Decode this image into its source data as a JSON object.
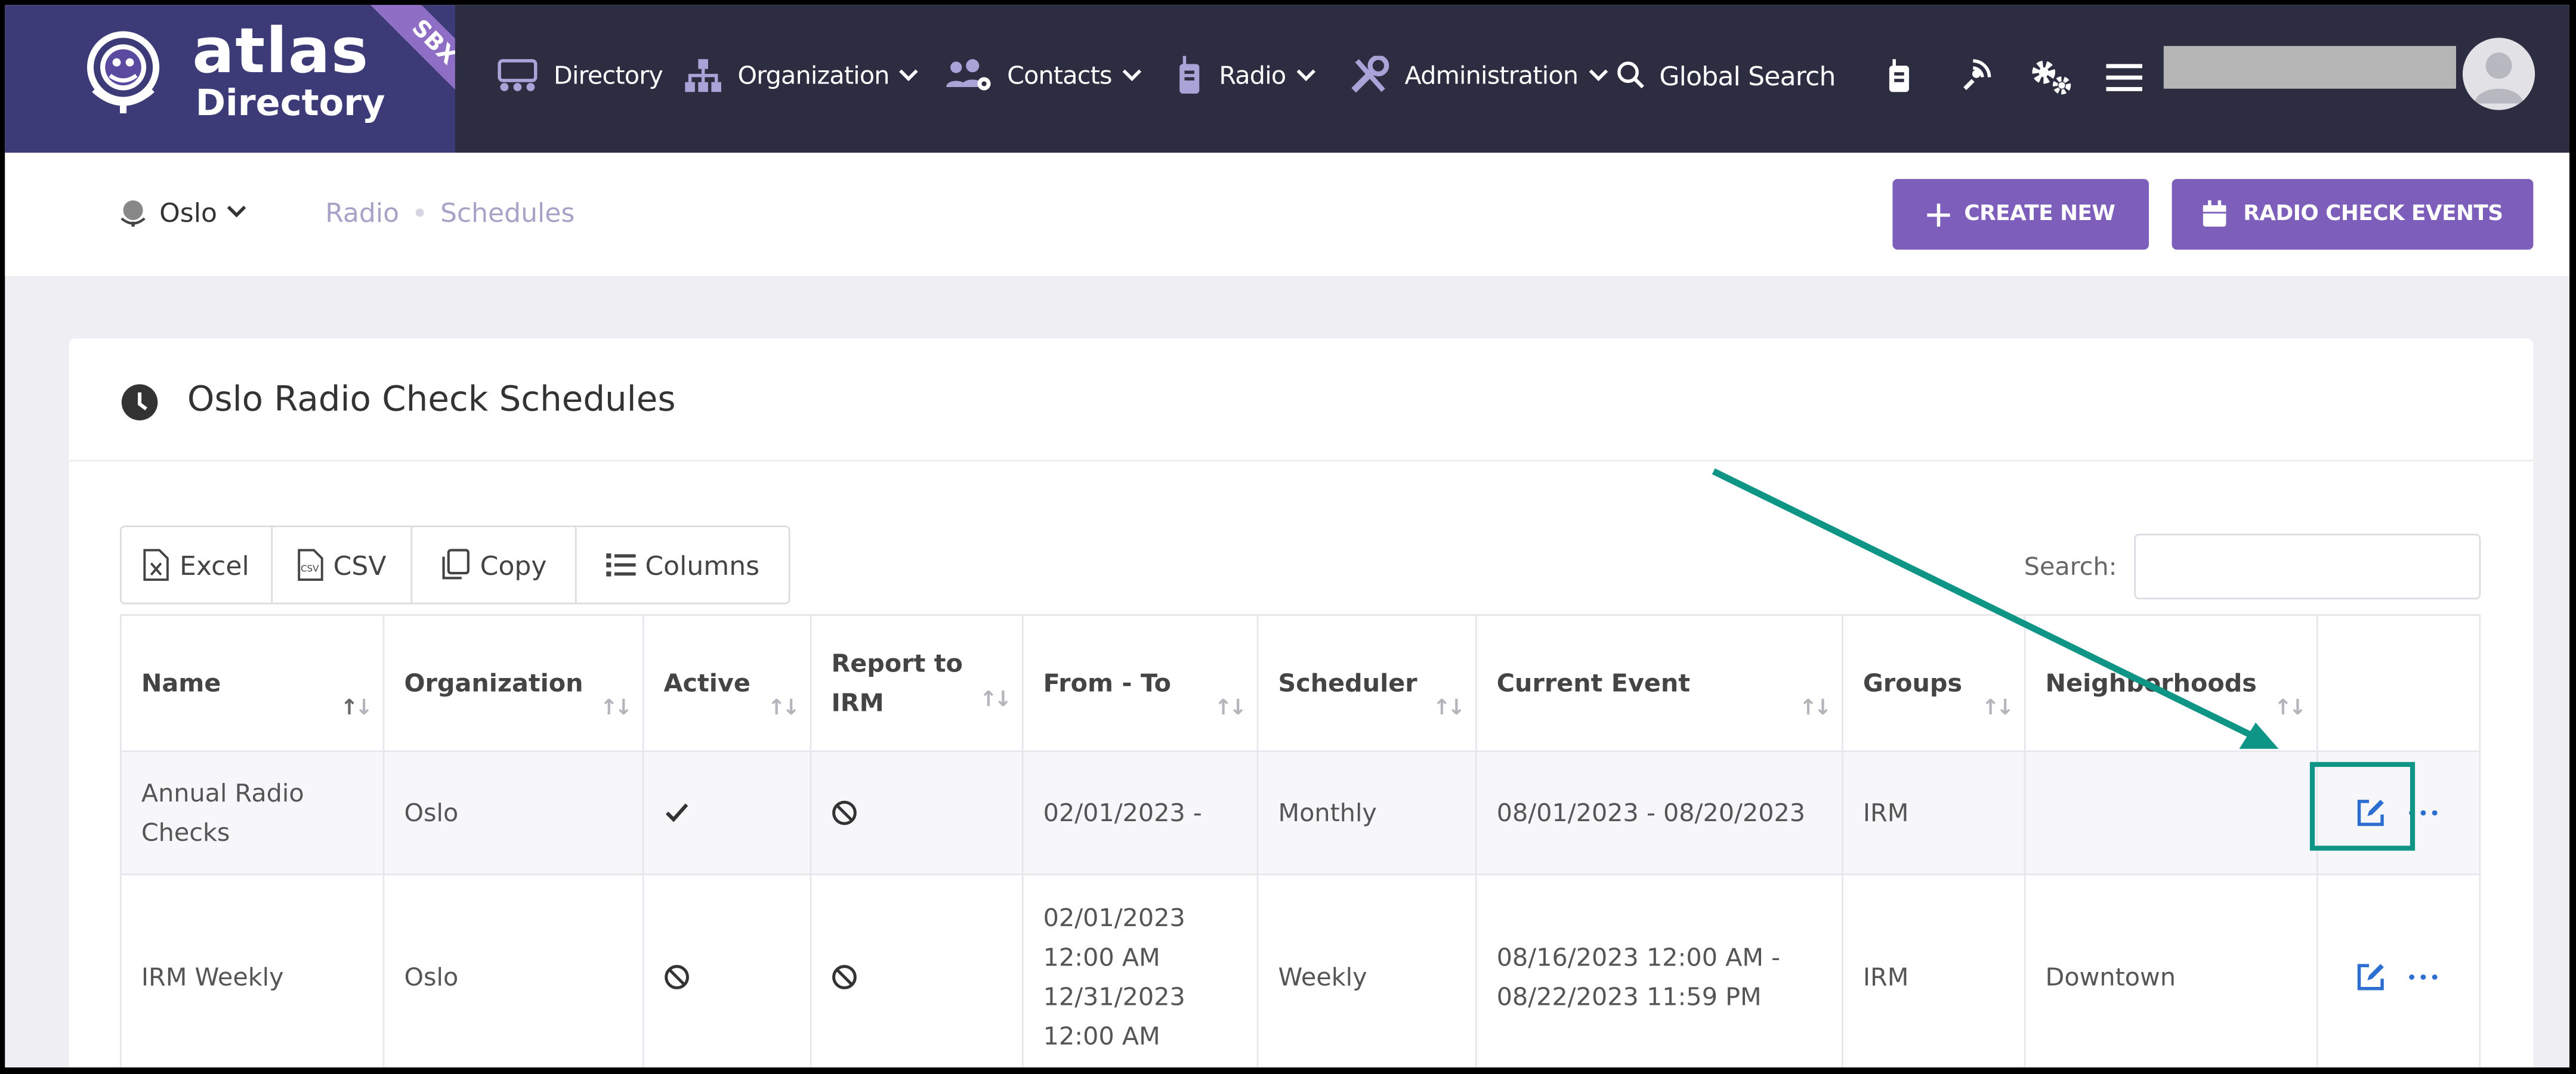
{
  "app": {
    "logo_word1": "atlas",
    "logo_word2": "Directory",
    "env_badge": "SBX"
  },
  "nav": {
    "items": [
      {
        "label": "Directory",
        "icon": "directory-icon"
      },
      {
        "label": "Organization",
        "icon": "organization-icon",
        "has_caret": true
      },
      {
        "label": "Contacts",
        "icon": "contacts-icon",
        "has_caret": true
      },
      {
        "label": "Radio",
        "icon": "radio-icon",
        "has_caret": true
      },
      {
        "label": "Administration",
        "icon": "tools-icon",
        "has_caret": true
      },
      {
        "label": "Global Search",
        "icon": "search-icon"
      }
    ],
    "icon_buttons": [
      "walkie-talkie-icon",
      "satellite-icon",
      "settings-gears-icon",
      "menu-icon"
    ]
  },
  "subheader": {
    "location": "Oslo",
    "breadcrumb": [
      "Radio",
      "Schedules"
    ],
    "create_new_label": "CREATE NEW",
    "radio_check_events_label": "RADIO CHECK EVENTS"
  },
  "card": {
    "title": "Oslo Radio Check Schedules",
    "export_buttons": [
      "Excel",
      "CSV",
      "Copy",
      "Columns"
    ],
    "search_label": "Search:",
    "search_value": ""
  },
  "table": {
    "headers": [
      "Name",
      "Organization",
      "Active",
      "Report to IRM",
      "From - To",
      "Scheduler",
      "Current Event",
      "Groups",
      "Neighborhoods",
      ""
    ],
    "header_lines": {
      "report_line1": "Report to",
      "report_line2": "IRM"
    },
    "rows": [
      {
        "name_line1": "Annual Radio",
        "name_line2": "Checks",
        "organization": "Oslo",
        "active": "check",
        "report_to_irm": "no",
        "from_to_line1": "02/01/2023 -",
        "scheduler": "Monthly",
        "current_event_line1": "08/01/2023 - 08/20/2023",
        "groups": "IRM",
        "neighborhoods": ""
      },
      {
        "name": "IRM Weekly",
        "organization": "Oslo",
        "active": "no",
        "report_to_irm": "no",
        "from_to_line1": "02/01/2023",
        "from_to_line2": "12:00 AM",
        "from_to_line3": "12/31/2023",
        "from_to_line4": "12:00 AM",
        "scheduler": "Weekly",
        "current_event_line1": "08/16/2023 12:00 AM -",
        "current_event_line2": "08/22/2023 11:59 PM",
        "groups": "IRM",
        "neighborhoods": "Downtown"
      }
    ]
  },
  "colors": {
    "nav_bg": "#2d2d42",
    "brand_purple": "#7d5fbb",
    "link_blue": "#2d6fd1",
    "annotation_teal": "#0e9585"
  }
}
